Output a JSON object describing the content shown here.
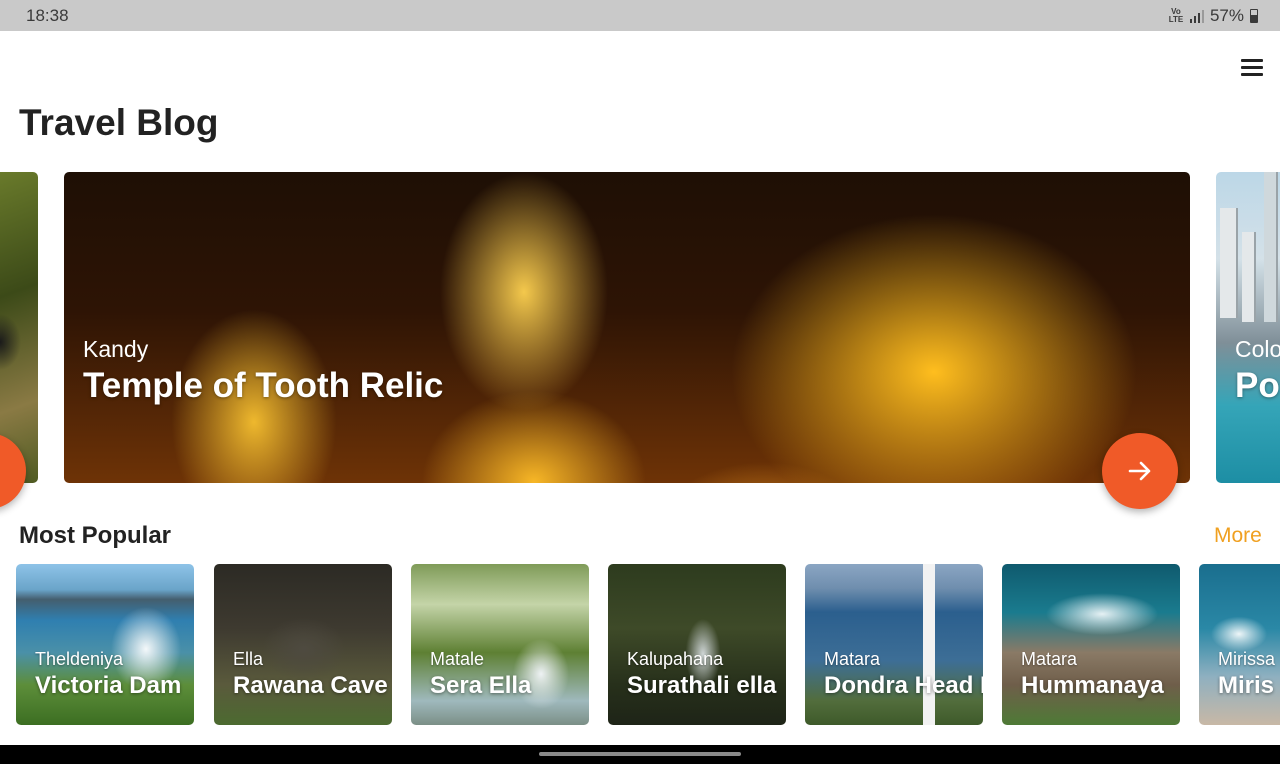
{
  "status_bar": {
    "time": "18:38",
    "network": "VoLTE",
    "battery": "57%",
    "battery_level": 0.57,
    "icons": [
      "volte-icon",
      "signal-icon",
      "battery-icon"
    ]
  },
  "header": {
    "menu_icon": "hamburger-menu-icon"
  },
  "page": {
    "title": "Travel Blog"
  },
  "carousel": {
    "items": [
      {
        "label": "",
        "title": ""
      },
      {
        "label": "Kandy",
        "title": "Temple of Tooth Relic"
      },
      {
        "label": "Colo",
        "title": "Po"
      }
    ],
    "prev_icon": "arrow-left-icon",
    "next_icon": "arrow-right-icon",
    "accent_color": "#f05a28"
  },
  "popular": {
    "title": "Most Popular",
    "more_label": "More",
    "more_color": "#f0a020",
    "items": [
      {
        "label": "Theldeniya",
        "title": "Victoria Dam"
      },
      {
        "label": "Ella",
        "title": "Rawana Cave"
      },
      {
        "label": "Matale",
        "title": "Sera Ella"
      },
      {
        "label": "Kalupahana",
        "title": "Surathali ella"
      },
      {
        "label": "Matara",
        "title": "Dondra Head L"
      },
      {
        "label": "Matara",
        "title": "Hummanaya"
      },
      {
        "label": "Mirissa",
        "title": "Miris"
      }
    ]
  }
}
